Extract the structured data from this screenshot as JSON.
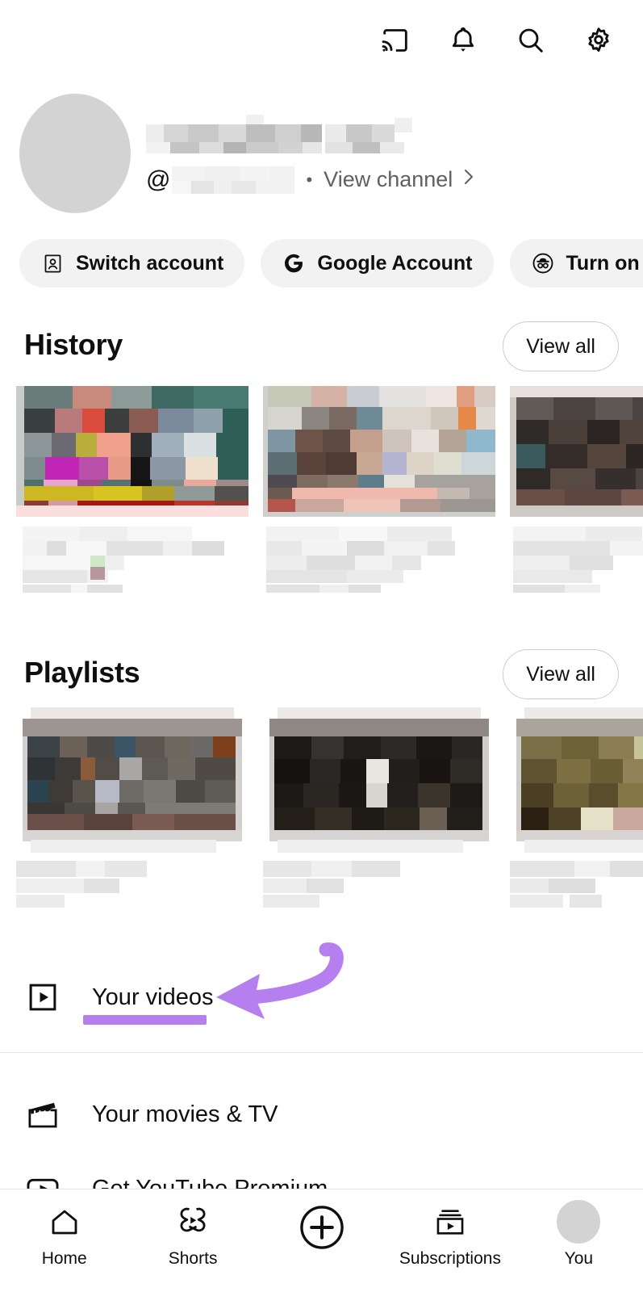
{
  "app": {
    "name": "YouTube",
    "screen": "You"
  },
  "topbar": {
    "icons": [
      {
        "name": "cast-icon",
        "label": "Cast"
      },
      {
        "name": "bell-icon",
        "label": "Notifications"
      },
      {
        "name": "search-icon",
        "label": "Search"
      },
      {
        "name": "gear-icon",
        "label": "Settings"
      }
    ]
  },
  "profile": {
    "display_name": "",
    "display_name_redacted": true,
    "handle_prefix": "@",
    "handle": "",
    "handle_redacted": true,
    "separator": "•",
    "view_channel_label": "View channel",
    "chevron": "›",
    "avatar": {
      "name": "avatar",
      "redacted": true
    }
  },
  "chips": [
    {
      "label": "Switch account",
      "icon": "switch-account-icon"
    },
    {
      "label": "Google Account",
      "icon": "google-g-icon"
    },
    {
      "label": "Turn on Incognito",
      "icon": "incognito-icon",
      "truncated": true
    }
  ],
  "sections": [
    {
      "key": "history",
      "title": "History",
      "view_all_label": "View all",
      "items": [
        {
          "title_redacted": true,
          "thumb_redacted": true
        },
        {
          "title_redacted": true,
          "thumb_redacted": true
        },
        {
          "title_redacted": true,
          "thumb_redacted": true
        }
      ]
    },
    {
      "key": "playlists",
      "title": "Playlists",
      "view_all_label": "View all",
      "items": [
        {
          "title_redacted": true,
          "thumb_redacted": true
        },
        {
          "title_redacted": true,
          "thumb_redacted": true
        },
        {
          "title_redacted": true,
          "thumb_redacted": true
        }
      ]
    }
  ],
  "menu_rows": [
    {
      "label": "Your videos",
      "icon": "play-square-icon",
      "highlighted": true
    },
    {
      "label": "Your movies & TV",
      "icon": "clapperboard-icon",
      "highlighted": false
    },
    {
      "label": "Get YouTube Premium",
      "icon": "youtube-play-icon",
      "highlighted": false
    }
  ],
  "annotation": {
    "color": "#b57ff0",
    "type": "arrow-and-underline",
    "target_label": "Your videos"
  },
  "bottom_nav": {
    "items": [
      {
        "label": "Home",
        "icon": "home-icon",
        "active": false
      },
      {
        "label": "Shorts",
        "icon": "shorts-icon",
        "active": false
      },
      {
        "label": "",
        "icon": "create-plus-icon",
        "active": false
      },
      {
        "label": "Subscriptions",
        "icon": "subscriptions-icon",
        "active": false
      },
      {
        "label": "You",
        "icon": "avatar-icon",
        "active": true
      }
    ]
  }
}
